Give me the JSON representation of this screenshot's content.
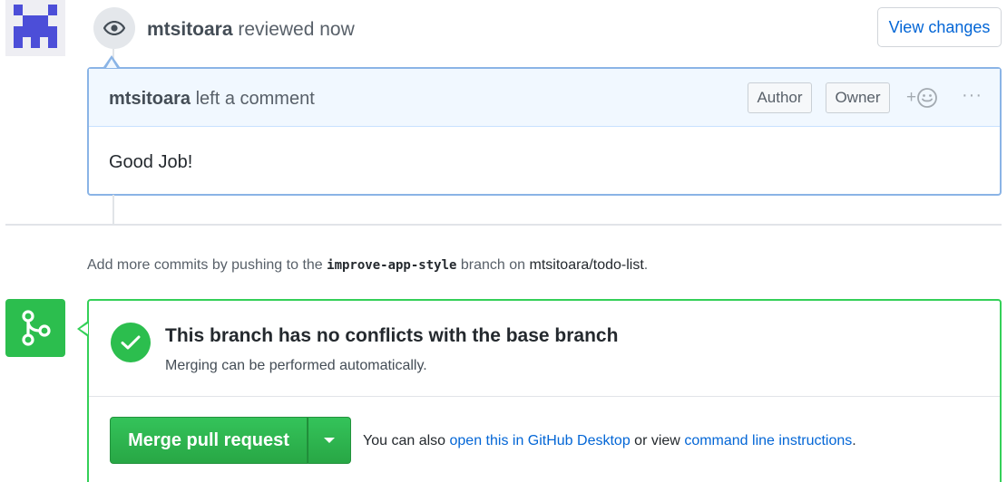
{
  "review_event": {
    "user": "mtsitoara",
    "action": "reviewed now",
    "view_changes_label": "View changes"
  },
  "comment": {
    "user": "mtsitoara",
    "action": "left a comment",
    "badges": [
      "Author",
      "Owner"
    ],
    "reaction_plus": "+",
    "more": "···",
    "body": "Good Job!"
  },
  "push_hint": {
    "prefix": "Add more commits by pushing to the",
    "branch": "improve-app-style",
    "middle": "branch on",
    "repo": "mtsitoara/todo-list",
    "suffix": "."
  },
  "merge": {
    "title": "This branch has no conflicts with the base branch",
    "subtitle": "Merging can be performed automatically.",
    "button_label": "Merge pull request",
    "also_prefix": "You can also",
    "desktop_link": "open this in GitHub Desktop",
    "also_middle": "or view",
    "cli_link": "command line instructions",
    "also_suffix": "."
  },
  "colors": {
    "link": "#0366d6",
    "success": "#2cbe4e",
    "comment_border": "#8ab4e6",
    "comment_header_bg": "#f1f8ff"
  },
  "icons": {
    "avatar": "identicon",
    "review": "eye-icon",
    "reaction": "smiley-icon",
    "merge": "git-merge-icon",
    "status": "check-icon",
    "dropdown": "caret-down-icon"
  }
}
